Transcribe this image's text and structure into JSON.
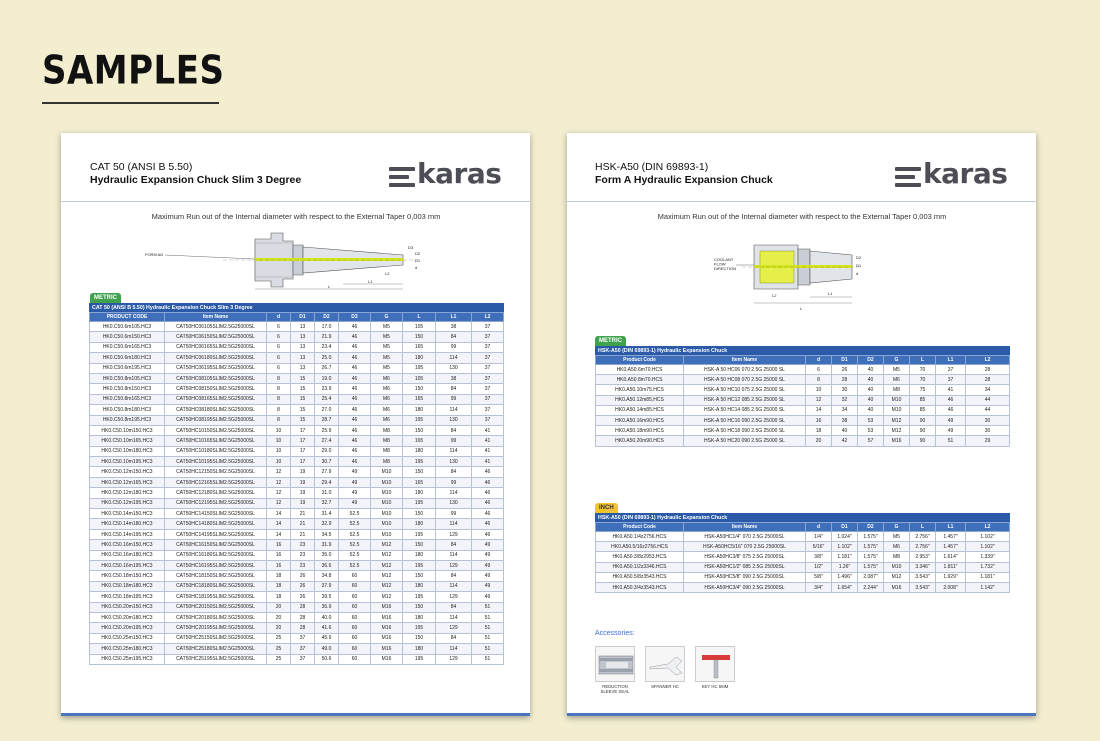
{
  "page": {
    "heading": "SAMPLES"
  },
  "left_sheet": {
    "title_line1": "CAT 50 (ANSI B 5.50)",
    "title_line2": "Hydraulic Expansion Chuck Slim 3 Degree",
    "logo_text": "karas",
    "runout_text": "Maximum Run out of the Internal diameter with respect to the External Taper 0,003 mm",
    "drawing_labels": {
      "form": "FORM AD",
      "dims": [
        "D3",
        "D2",
        "D1",
        "d",
        "L2",
        "L1",
        "L"
      ]
    },
    "tag": "METRIC",
    "table_caption": "CAT 50 (ANSI B 5.50) Hydraulic Expansion Chuck Slim 3 Degree",
    "columns": [
      "PRODUCT CODE",
      "Item Name",
      "d",
      "D1",
      "D2",
      "D3",
      "G",
      "L",
      "L1",
      "L2"
    ],
    "rows": [
      [
        "HK0.C50.6m105.HC3",
        "CAT50HC06105SLIM2.5G25000SL",
        "6",
        "13",
        "17.0",
        "46",
        "M5",
        "105",
        "38",
        "37"
      ],
      [
        "HK0.C50.6m150.HC3",
        "CAT50HC06150SLIM2.5G25000SL",
        "6",
        "13",
        "21.9",
        "46",
        "M5",
        "150",
        "84",
        "37"
      ],
      [
        "HK0.C50.6m165.HC3",
        "CAT50HC06165SLIM2.5G25000SL",
        "6",
        "13",
        "23.4",
        "46",
        "M5",
        "165",
        "99",
        "37"
      ],
      [
        "HK0.C50.6m180.HC3",
        "CAT50HC06180SLIM2.5G25000SL",
        "6",
        "13",
        "25.0",
        "46",
        "M5",
        "180",
        "114",
        "37"
      ],
      [
        "HK0.C50.6m195.HC3",
        "CAT50HC06195SLIM2.5G25000SL",
        "6",
        "13",
        "26.7",
        "46",
        "M5",
        "195",
        "130",
        "37"
      ],
      [
        "HK0.C50.8m105.HC3",
        "CAT50HC08105SLIM2.5G25000SL",
        "8",
        "15",
        "19.0",
        "46",
        "M6",
        "105",
        "38",
        "37"
      ],
      [
        "HK0.C50.8m150.HC3",
        "CAT50HC08150SLIM2.5G25000SL",
        "8",
        "15",
        "23.9",
        "46",
        "M6",
        "150",
        "84",
        "37"
      ],
      [
        "HK0.C50.8m165.HC3",
        "CAT50HC08165SLIM2.5G25000SL",
        "8",
        "15",
        "25.4",
        "46",
        "M6",
        "165",
        "99",
        "37"
      ],
      [
        "HK0.C50.8m180.HC3",
        "CAT50HC08180SLIM2.5G25000SL",
        "8",
        "15",
        "27.0",
        "46",
        "M6",
        "180",
        "114",
        "37"
      ],
      [
        "HK0.C50.8m195.HC3",
        "CAT50HC08195SLIM2.5G25000SL",
        "8",
        "15",
        "28.7",
        "46",
        "M6",
        "195",
        "130",
        "37"
      ],
      [
        "HK0.C50.10m150.HC3",
        "CAT50HC10150SLIM2.5G25000SL",
        "10",
        "17",
        "25.9",
        "46",
        "M8",
        "150",
        "84",
        "41"
      ],
      [
        "HK0.C50.10m165.HC3",
        "CAT50HC10165SLIM2.5G25000SL",
        "10",
        "17",
        "27.4",
        "46",
        "M8",
        "165",
        "99",
        "41"
      ],
      [
        "HK0.C50.10m180.HC3",
        "CAT50HC10180SLIM2.5G25000SL",
        "10",
        "17",
        "29.0",
        "46",
        "M8",
        "180",
        "114",
        "41"
      ],
      [
        "HK0.C50.10m195.HC3",
        "CAT50HC10195SLIM2.5G25000SL",
        "10",
        "17",
        "30.7",
        "46",
        "M8",
        "195",
        "130",
        "41"
      ],
      [
        "HK0.C50.12m150.HC3",
        "CAT50HC12150SLIM2.5G25000SL",
        "12",
        "19",
        "27.9",
        "49",
        "M10",
        "150",
        "84",
        "46"
      ],
      [
        "HK0.C50.12m165.HC3",
        "CAT50HC12165SLIM2.5G25000SL",
        "12",
        "19",
        "29.4",
        "49",
        "M10",
        "165",
        "99",
        "46"
      ],
      [
        "HK0.C50.12m180.HC3",
        "CAT50HC12180SLIM2.5G25000SL",
        "12",
        "19",
        "31.0",
        "49",
        "M10",
        "180",
        "114",
        "46"
      ],
      [
        "HK0.C50.12m195.HC3",
        "CAT50HC12195SLIM2.5G25000SL",
        "12",
        "19",
        "32.7",
        "49",
        "M10",
        "195",
        "130",
        "46"
      ],
      [
        "HK0.C50.14m150.HC3",
        "CAT50HC14150SLIM2.5G25000SL",
        "14",
        "21",
        "31.4",
        "52.5",
        "M10",
        "150",
        "99",
        "46"
      ],
      [
        "HK0.C50.14m180.HC3",
        "CAT50HC14180SLIM2.5G25000SL",
        "14",
        "21",
        "32.9",
        "52.5",
        "M10",
        "180",
        "114",
        "46"
      ],
      [
        "HK0.C50.14m195.HC3",
        "CAT50HC14195SLIM2.5G25000SL",
        "14",
        "21",
        "34.5",
        "52.5",
        "M10",
        "195",
        "129",
        "46"
      ],
      [
        "HK0.C50.16m150.HC3",
        "CAT50HC16150SLIM2.5G25000SL",
        "16",
        "23",
        "31.9",
        "52.5",
        "M12",
        "150",
        "84",
        "49"
      ],
      [
        "HK0.C50.16m180.HC3",
        "CAT50HC16180SLIM2.5G25000SL",
        "16",
        "23",
        "35.0",
        "52.5",
        "M12",
        "180",
        "114",
        "49"
      ],
      [
        "HK0.C50.16m195.HC3",
        "CAT50HC16195SLIM2.5G25000SL",
        "16",
        "23",
        "36.6",
        "52.5",
        "M12",
        "195",
        "129",
        "49"
      ],
      [
        "HK0.C50.18m150.HC3",
        "CAT50HC18150SLIM2.5G25000SL",
        "18",
        "26",
        "34.8",
        "60",
        "M12",
        "150",
        "84",
        "49"
      ],
      [
        "HK0.C50.18m180.HC3",
        "CAT50HC18180SLIM2.5G25000SL",
        "18",
        "26",
        "37.9",
        "60",
        "M12",
        "180",
        "114",
        "49"
      ],
      [
        "HK0.C50.18m195.HC3",
        "CAT50HC18195SLIM2.5G25000SL",
        "18",
        "26",
        "39.5",
        "60",
        "M12",
        "195",
        "129",
        "49"
      ],
      [
        "HK0.C50.20m150.HC3",
        "CAT50HC20150SLIM2.5G25000SL",
        "20",
        "28",
        "36.9",
        "60",
        "M16",
        "150",
        "84",
        "51"
      ],
      [
        "HK0.C50.20m180.HC3",
        "CAT50HC20180SLIM2.5G25000SL",
        "20",
        "28",
        "40.0",
        "60",
        "M16",
        "180",
        "114",
        "51"
      ],
      [
        "HK0.C50.20m195.HC3",
        "CAT50HC20195SLIM2.5G25000SL",
        "20",
        "28",
        "41.6",
        "60",
        "M16",
        "195",
        "129",
        "51"
      ],
      [
        "HK0.C50.25m150.HC3",
        "CAT50HC25150SLIM2.5G25000SL",
        "25",
        "37",
        "45.9",
        "60",
        "M16",
        "150",
        "84",
        "51"
      ],
      [
        "HK0.C50.25m180.HC3",
        "CAT50HC25180SLIM2.5G25000SL",
        "25",
        "37",
        "49.0",
        "60",
        "M16",
        "180",
        "114",
        "51"
      ],
      [
        "HK0.C50.25m195.HC3",
        "CAT50HC25195SLIM2.5G25000SL",
        "25",
        "37",
        "50.6",
        "60",
        "M16",
        "195",
        "129",
        "51"
      ]
    ]
  },
  "right_sheet": {
    "title_line1": "HSK-A50 (DIN 69893-1)",
    "title_line2": "Form A Hydraulic Expansion Chuck",
    "logo_text": "karas",
    "runout_text": "Maximum Run out of the Internal diameter with respect to the External Taper 0,003 mm",
    "drawing_labels": {
      "coolant": "COOLANT FLOW DIRECTION",
      "dims": [
        "D2",
        "D1",
        "d",
        "L2",
        "L1",
        "L"
      ]
    },
    "metric_tag": "METRIC",
    "metric_caption": "HSK-A50 (DIN 69893-1) Hydraulic Expansion Chuck",
    "metric_columns": [
      "Product Code",
      "Item Name",
      "d",
      "D1",
      "D2",
      "G",
      "L",
      "L1",
      "L2"
    ],
    "metric_rows": [
      [
        "HK0.A50.6m70.HCS",
        "HSK-A 50 HC06 070 2.5G 25000 SL",
        "6",
        "26",
        "40",
        "M5",
        "70",
        "37",
        "28"
      ],
      [
        "HK0.A50.8m70.HCS",
        "HSK-A 50 HC08 070 2.5G 25000 SL",
        "8",
        "28",
        "40",
        "M6",
        "70",
        "37",
        "28"
      ],
      [
        "HK0.A50.10m75.HCS",
        "HSK-A 50 HC10 075 2.5G 25000 SL",
        "10",
        "30",
        "40",
        "M8",
        "75",
        "41",
        "34"
      ],
      [
        "HK0.A50.12m85.HCS",
        "HSK-A 50 HC12 085 2.5G 25000 SL",
        "12",
        "32",
        "40",
        "M10",
        "85",
        "46",
        "44"
      ],
      [
        "HK0.A50.14m85.HCS",
        "HSK-A 50 HC14 085 2.5G 25000 SL",
        "14",
        "34",
        "40",
        "M10",
        "85",
        "46",
        "44"
      ],
      [
        "HK0.A50.16m90.HCS",
        "HSK-A 50 HC16 090 2.5G 25000 SL",
        "16",
        "38",
        "53",
        "M12",
        "90",
        "49",
        "30"
      ],
      [
        "HK0.A50.18m90.HCS",
        "HSK-A 50 HC18 090 2.5G 25000 SL",
        "18",
        "40",
        "53",
        "M12",
        "90",
        "49",
        "30"
      ],
      [
        "HK0.A50.20m90.HCS",
        "HSK-A 50 HC20 090 2.5G 25000 SL",
        "20",
        "42",
        "57",
        "M16",
        "90",
        "51",
        "29"
      ]
    ],
    "inch_tag": "INCH",
    "inch_caption": "HSK-A50 (DIN 69893-1) Hydraulic Expansion Chuck",
    "inch_columns": [
      "Product Code",
      "Item Name",
      "d",
      "D1",
      "D2",
      "G",
      "L",
      "L1",
      "L2"
    ],
    "inch_rows": [
      [
        "HK0.A50.1/4z2756.HCS",
        "HSK-A50HC1/4\" 070 2.5G 25000SL",
        "1/4\"",
        "1.024\"",
        "1.575\"",
        "M5",
        "2.756\"",
        "1.457\"",
        "1.102\""
      ],
      [
        "HK0.A50.5/16z2756.HCS",
        "HSK-A50HC5/16\" 070 2.5G 25000SL",
        "5/16\"",
        "1.102\"",
        "1.575\"",
        "M6",
        "2.756\"",
        "1.457\"",
        "1.102\""
      ],
      [
        "HK0.A50.3/8z2953.HCS",
        "HSK-A50HC3/8\" 075 2.5G 25000SL",
        "3/8\"",
        "1.181\"",
        "1.575\"",
        "M8",
        "2.953\"",
        "1.614\"",
        "1.339\""
      ],
      [
        "HK0.A50.1/2z3346.HCS",
        "HSK-A50HC1/2\" 085 2.5G 25000SL",
        "1/2\"",
        "1.26\"",
        "1.575\"",
        "M10",
        "3.346\"",
        "1.811\"",
        "1.732\""
      ],
      [
        "HK0.A50.5/8z3543.HCS",
        "HSK-A50HC5/8\" 090 2.5G 25000SL",
        "5/8\"",
        "1.496\"",
        "2.087\"",
        "M12",
        "3.543\"",
        "1.929\"",
        "1.181\""
      ],
      [
        "HK0.A50.3/4z3543.HCS",
        "HSK-A50HC3/4\" 090 2.5G 25000SL",
        "3/4\"",
        "1.654\"",
        "2.244\"",
        "M16",
        "3.543\"",
        "2.008\"",
        "1.142\""
      ]
    ],
    "accessories_title": "Accessories:",
    "accessories": [
      {
        "label": "REDUCTION SLEEVE SEAL",
        "icon": "reduction-sleeve-icon"
      },
      {
        "label": "SPANNER HC",
        "icon": "spanner-icon"
      },
      {
        "label": "KEY HC 5MM",
        "icon": "key-icon"
      }
    ]
  }
}
